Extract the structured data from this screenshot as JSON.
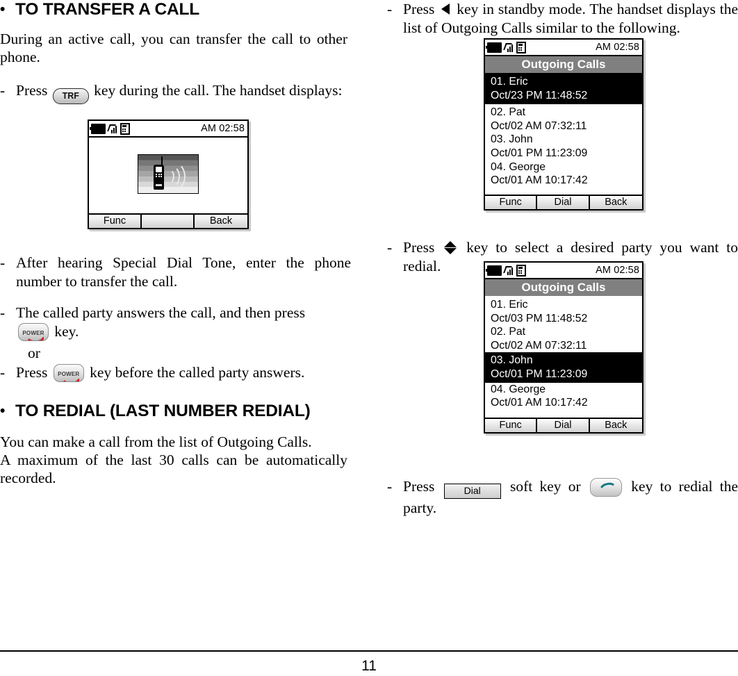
{
  "page": {
    "number": "11"
  },
  "left_column": {
    "section1": {
      "bullet": "•",
      "heading": "TO TRANSFER A CALL",
      "intro": "During an active call, you can transfer the call to other phone.",
      "steps": [
        {
          "dash": "-",
          "text_before": "Press",
          "key": "TRF",
          "text_after": "key during the call. The handset displays:"
        },
        {
          "dash": "-",
          "text": "After hearing Special Dial Tone, enter the phone number to transfer the call."
        },
        {
          "dash": "-",
          "text_before": "The called party answers the call, and then press",
          "key": "POWER",
          "text_after": "key."
        },
        {
          "or": "or"
        },
        {
          "dash": "-",
          "text_before": "Press",
          "key": "POWER",
          "text_after": "key before the called party answers."
        }
      ]
    },
    "section2": {
      "bullet": "•",
      "heading": "TO REDIAL (LAST NUMBER REDIAL)",
      "paragraph1": "You can make a call from the list of Outgoing Calls.",
      "paragraph2": "A maximum of the last 30 calls can be automatically recorded."
    },
    "screen_transfer": {
      "status": {
        "battery_icon": "battery-icon",
        "signal_icon": "signal-bars-icon",
        "handset_icon": "handset-base-icon",
        "time": "AM 02:58"
      },
      "graphic": "calling-handset-graphic",
      "softkeys": [
        "Func",
        "",
        "Back"
      ]
    }
  },
  "right_column": {
    "steps": [
      {
        "dash": "-",
        "text_before": "Press",
        "key": "left-arrow",
        "text_after": "key in standby mode. The handset displays the list of Outgoing Calls similar to the following."
      },
      {
        "dash": "-",
        "text_before": "Press",
        "key": "up-down-arrow",
        "text_after": "key to select a desired party you want to redial."
      },
      {
        "dash": "-",
        "text_before": "Press",
        "key": "Dial",
        "text_mid": "soft key or",
        "key2": "talk-key",
        "text_after": "key to redial the party."
      }
    ],
    "screen_outgoing_1": {
      "status": {
        "time": "AM 02:58"
      },
      "title": "Outgoing Calls",
      "entries": [
        {
          "name": "01. Eric",
          "stamp": "Oct/23 PM 11:48:52",
          "selected": true
        },
        {
          "name": "02. Pat",
          "stamp": "Oct/02 AM 07:32:11",
          "selected": false
        },
        {
          "name": "03. John",
          "stamp": "Oct/01 PM 11:23:09",
          "selected": false
        },
        {
          "name": "04. George",
          "stamp": "Oct/01 AM 10:17:42",
          "selected": false
        }
      ],
      "softkeys": [
        "Func",
        "Dial",
        "Back"
      ]
    },
    "screen_outgoing_2": {
      "status": {
        "time": "AM 02:58"
      },
      "title": "Outgoing Calls",
      "entries": [
        {
          "name": "01. Eric",
          "stamp": "Oct/03 PM 11:48:52",
          "selected": false
        },
        {
          "name": "02. Pat",
          "stamp": "Oct/02 AM 07:32:11",
          "selected": false
        },
        {
          "name": "03. John",
          "stamp": "Oct/01 PM 11:23:09",
          "selected": true
        },
        {
          "name": "04. George",
          "stamp": "Oct/01 AM 10:17:42",
          "selected": false
        }
      ],
      "softkeys": [
        "Func",
        "Dial",
        "Back"
      ]
    }
  },
  "colors": {
    "title_bar": "#808080",
    "selected_row_bg": "#000000",
    "power_key_glyph": "#cc2222",
    "talk_key_glyph": "#117a86"
  }
}
